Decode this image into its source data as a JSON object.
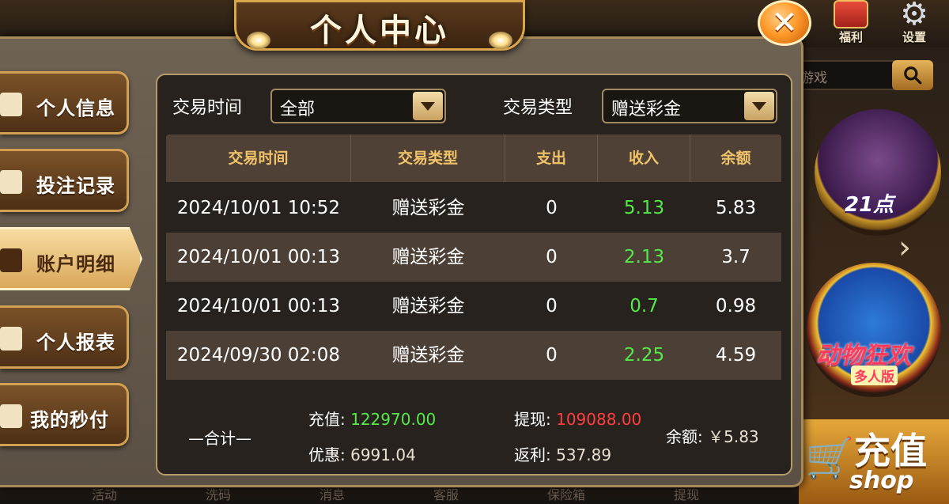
{
  "lobby": {
    "top_icons": [
      {
        "label": "福利",
        "icon": "gift-icon"
      },
      {
        "label": "设置",
        "icon": "gear-icon"
      }
    ],
    "search": {
      "placeholder": "游戏"
    },
    "games": [
      {
        "title": "21点"
      },
      {
        "title": "动物狂欢",
        "subtitle": "多人版"
      }
    ],
    "recharge": {
      "label": "充值",
      "sub": "shop"
    },
    "bottom_nav": [
      "活动",
      "洗码",
      "消息",
      "客服",
      "保险箱",
      "提现"
    ]
  },
  "modal": {
    "title": "个人中心",
    "sidebar": [
      {
        "label": "个人信息",
        "icon": "user-icon",
        "active": false
      },
      {
        "label": "投注记录",
        "icon": "wallet-icon",
        "active": false
      },
      {
        "label": "账户明细",
        "icon": "ledger-icon",
        "active": true
      },
      {
        "label": "个人报表",
        "icon": "pie-chart-icon",
        "active": false
      },
      {
        "label": "我的秒付",
        "icon": "send-icon",
        "active": false
      }
    ],
    "filters": {
      "time_label": "交易时间",
      "time_value": "全部",
      "type_label": "交易类型",
      "type_value": "赠送彩金"
    },
    "table": {
      "headers": [
        "交易时间",
        "交易类型",
        "支出",
        "收入",
        "余额"
      ],
      "rows": [
        {
          "time": "2024/10/01 10:52",
          "type": "赠送彩金",
          "out": "0",
          "in": "5.13",
          "balance": "5.83"
        },
        {
          "time": "2024/10/01 00:13",
          "type": "赠送彩金",
          "out": "0",
          "in": "2.13",
          "balance": "3.7"
        },
        {
          "time": "2024/10/01 00:13",
          "type": "赠送彩金",
          "out": "0",
          "in": "0.7",
          "balance": "0.98"
        },
        {
          "time": "2024/09/30 02:08",
          "type": "赠送彩金",
          "out": "0",
          "in": "2.25",
          "balance": "4.59"
        }
      ]
    },
    "summary": {
      "label": "—合计—",
      "deposit_label": "充值:",
      "deposit_value": "122970.00",
      "withdraw_label": "提现:",
      "withdraw_value": "109088.00",
      "discount_label": "优惠:",
      "discount_value": "6991.04",
      "rebate_label": "返利:",
      "rebate_value": "537.89",
      "balance_label": "余额:",
      "balance_value": "￥5.83"
    }
  },
  "colors": {
    "income_green": "#55e94a",
    "withdraw_red": "#ff3f3f",
    "header_gold": "#f0c36a"
  }
}
